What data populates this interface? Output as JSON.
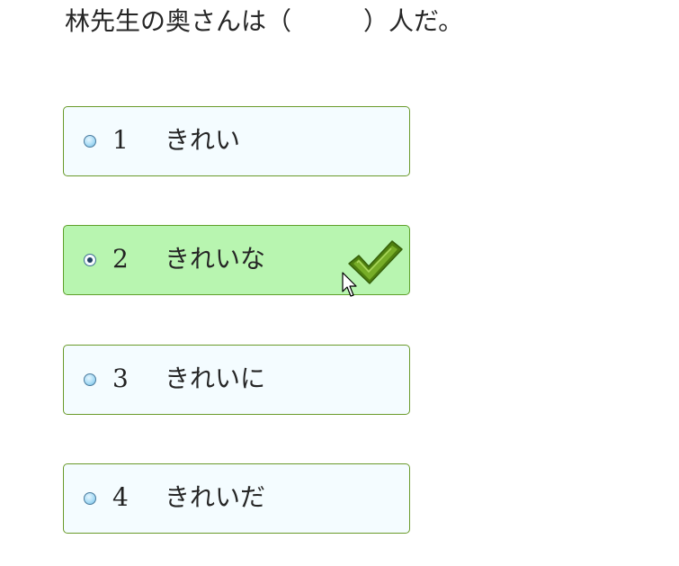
{
  "question": {
    "before": "林先生の奥さんは（",
    "after": "）人だ。"
  },
  "options": [
    {
      "number": "1",
      "text": "きれい",
      "selected": false
    },
    {
      "number": "2",
      "text": "きれいな",
      "selected": true
    },
    {
      "number": "3",
      "text": "きれいに",
      "selected": false
    },
    {
      "number": "4",
      "text": "きれいだ",
      "selected": false
    }
  ],
  "icons": {
    "correct": "checkmark-icon",
    "pointer": "mouse-cursor-icon"
  },
  "colors": {
    "selected_background": "#b8f5b0",
    "option_background": "#f4fcff",
    "option_border": "#6a9a2a",
    "checkmark": "#5a8c14"
  }
}
